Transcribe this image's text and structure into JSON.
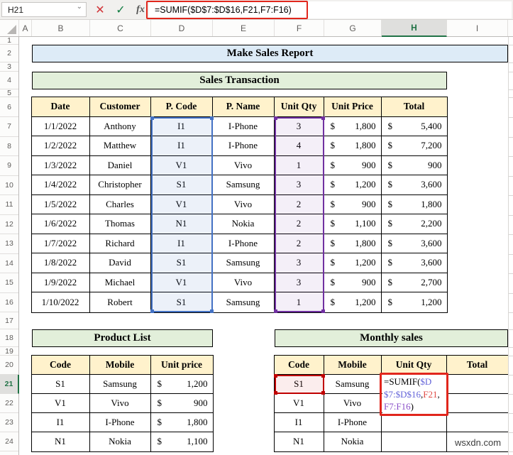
{
  "chrome": {
    "name_box": "H21",
    "formula": "=SUMIF($D$7:$D$16,F21,F7:F16)",
    "cancel_icon": "✕",
    "enter_icon": "✓",
    "fx_label": "fx"
  },
  "grid": {
    "columns": [
      "A",
      "B",
      "C",
      "D",
      "E",
      "F",
      "G",
      "H",
      "I"
    ],
    "selected_column": "H",
    "rows": [
      "1",
      "2",
      "3",
      "4",
      "5",
      "6",
      "7",
      "8",
      "9",
      "10",
      "11",
      "12",
      "13",
      "14",
      "15",
      "16",
      "17",
      "18",
      "19",
      "20",
      "21",
      "22",
      "23",
      "24"
    ],
    "selected_row": "21"
  },
  "titles": {
    "main": "Make Sales Report",
    "sales": "Sales Transaction",
    "product": "Product List",
    "monthly": "Monthly sales"
  },
  "currency": "$",
  "sales_table": {
    "headers": [
      "Date",
      "Customer",
      "P. Code",
      "P. Name",
      "Unit Qty",
      "Unit Price",
      "Total"
    ],
    "rows": [
      [
        "1/1/2022",
        "Anthony",
        "I1",
        "I-Phone",
        "3",
        "1,800",
        "5,400"
      ],
      [
        "1/2/2022",
        "Matthew",
        "I1",
        "I-Phone",
        "4",
        "1,800",
        "7,200"
      ],
      [
        "1/3/2022",
        "Daniel",
        "V1",
        "Vivo",
        "1",
        "900",
        "900"
      ],
      [
        "1/4/2022",
        "Christopher",
        "S1",
        "Samsung",
        "3",
        "1,200",
        "3,600"
      ],
      [
        "1/5/2022",
        "Charles",
        "V1",
        "Vivo",
        "2",
        "900",
        "1,800"
      ],
      [
        "1/6/2022",
        "Thomas",
        "N1",
        "Nokia",
        "2",
        "1,100",
        "2,200"
      ],
      [
        "1/7/2022",
        "Richard",
        "I1",
        "I-Phone",
        "2",
        "1,800",
        "3,600"
      ],
      [
        "1/8/2022",
        "David",
        "S1",
        "Samsung",
        "3",
        "1,200",
        "3,600"
      ],
      [
        "1/9/2022",
        "Michael",
        "V1",
        "Vivo",
        "3",
        "900",
        "2,700"
      ],
      [
        "1/10/2022",
        "Robert",
        "S1",
        "Samsung",
        "1",
        "1,200",
        "1,200"
      ]
    ]
  },
  "product_table": {
    "headers": [
      "Code",
      "Mobile",
      "Unit price"
    ],
    "rows": [
      [
        "S1",
        "Samsung",
        "1,200"
      ],
      [
        "V1",
        "Vivo",
        "900"
      ],
      [
        "I1",
        "I-Phone",
        "1,800"
      ],
      [
        "N1",
        "Nokia",
        "1,100"
      ]
    ]
  },
  "monthly_table": {
    "headers": [
      "Code",
      "Mobile",
      "Unit Qty",
      "Total"
    ],
    "rows": [
      [
        "S1",
        "Samsung",
        "",
        ""
      ],
      [
        "V1",
        "Vivo",
        "",
        ""
      ],
      [
        "I1",
        "I-Phone",
        "",
        ""
      ],
      [
        "N1",
        "Nokia",
        "",
        ""
      ]
    ],
    "formula_cell": {
      "cell": "H21",
      "segments": [
        {
          "text": "=SUMIF(",
          "color": "#000000"
        },
        {
          "text": "$D$7:$D$16",
          "color": "#6464D9"
        },
        {
          "text": ",",
          "color": "#000000"
        },
        {
          "text": "F21",
          "color": "#E04A45"
        },
        {
          "text": ",",
          "color": "#000000"
        },
        {
          "text": "F7:F16",
          "color": "#8A4FC8"
        },
        {
          "text": ")",
          "color": "#000000"
        }
      ]
    }
  },
  "watermark": "wsxdn.com",
  "colors": {
    "accent_green": "#217346",
    "banner_blue": "#DDEBF7",
    "banner_green": "#E2EFDA",
    "header_yellow": "#FFF2CC",
    "annotation_red": "#E1261C",
    "range_blue": "#4472C4",
    "range_purple": "#7030A0",
    "range_red": "#C00000"
  }
}
